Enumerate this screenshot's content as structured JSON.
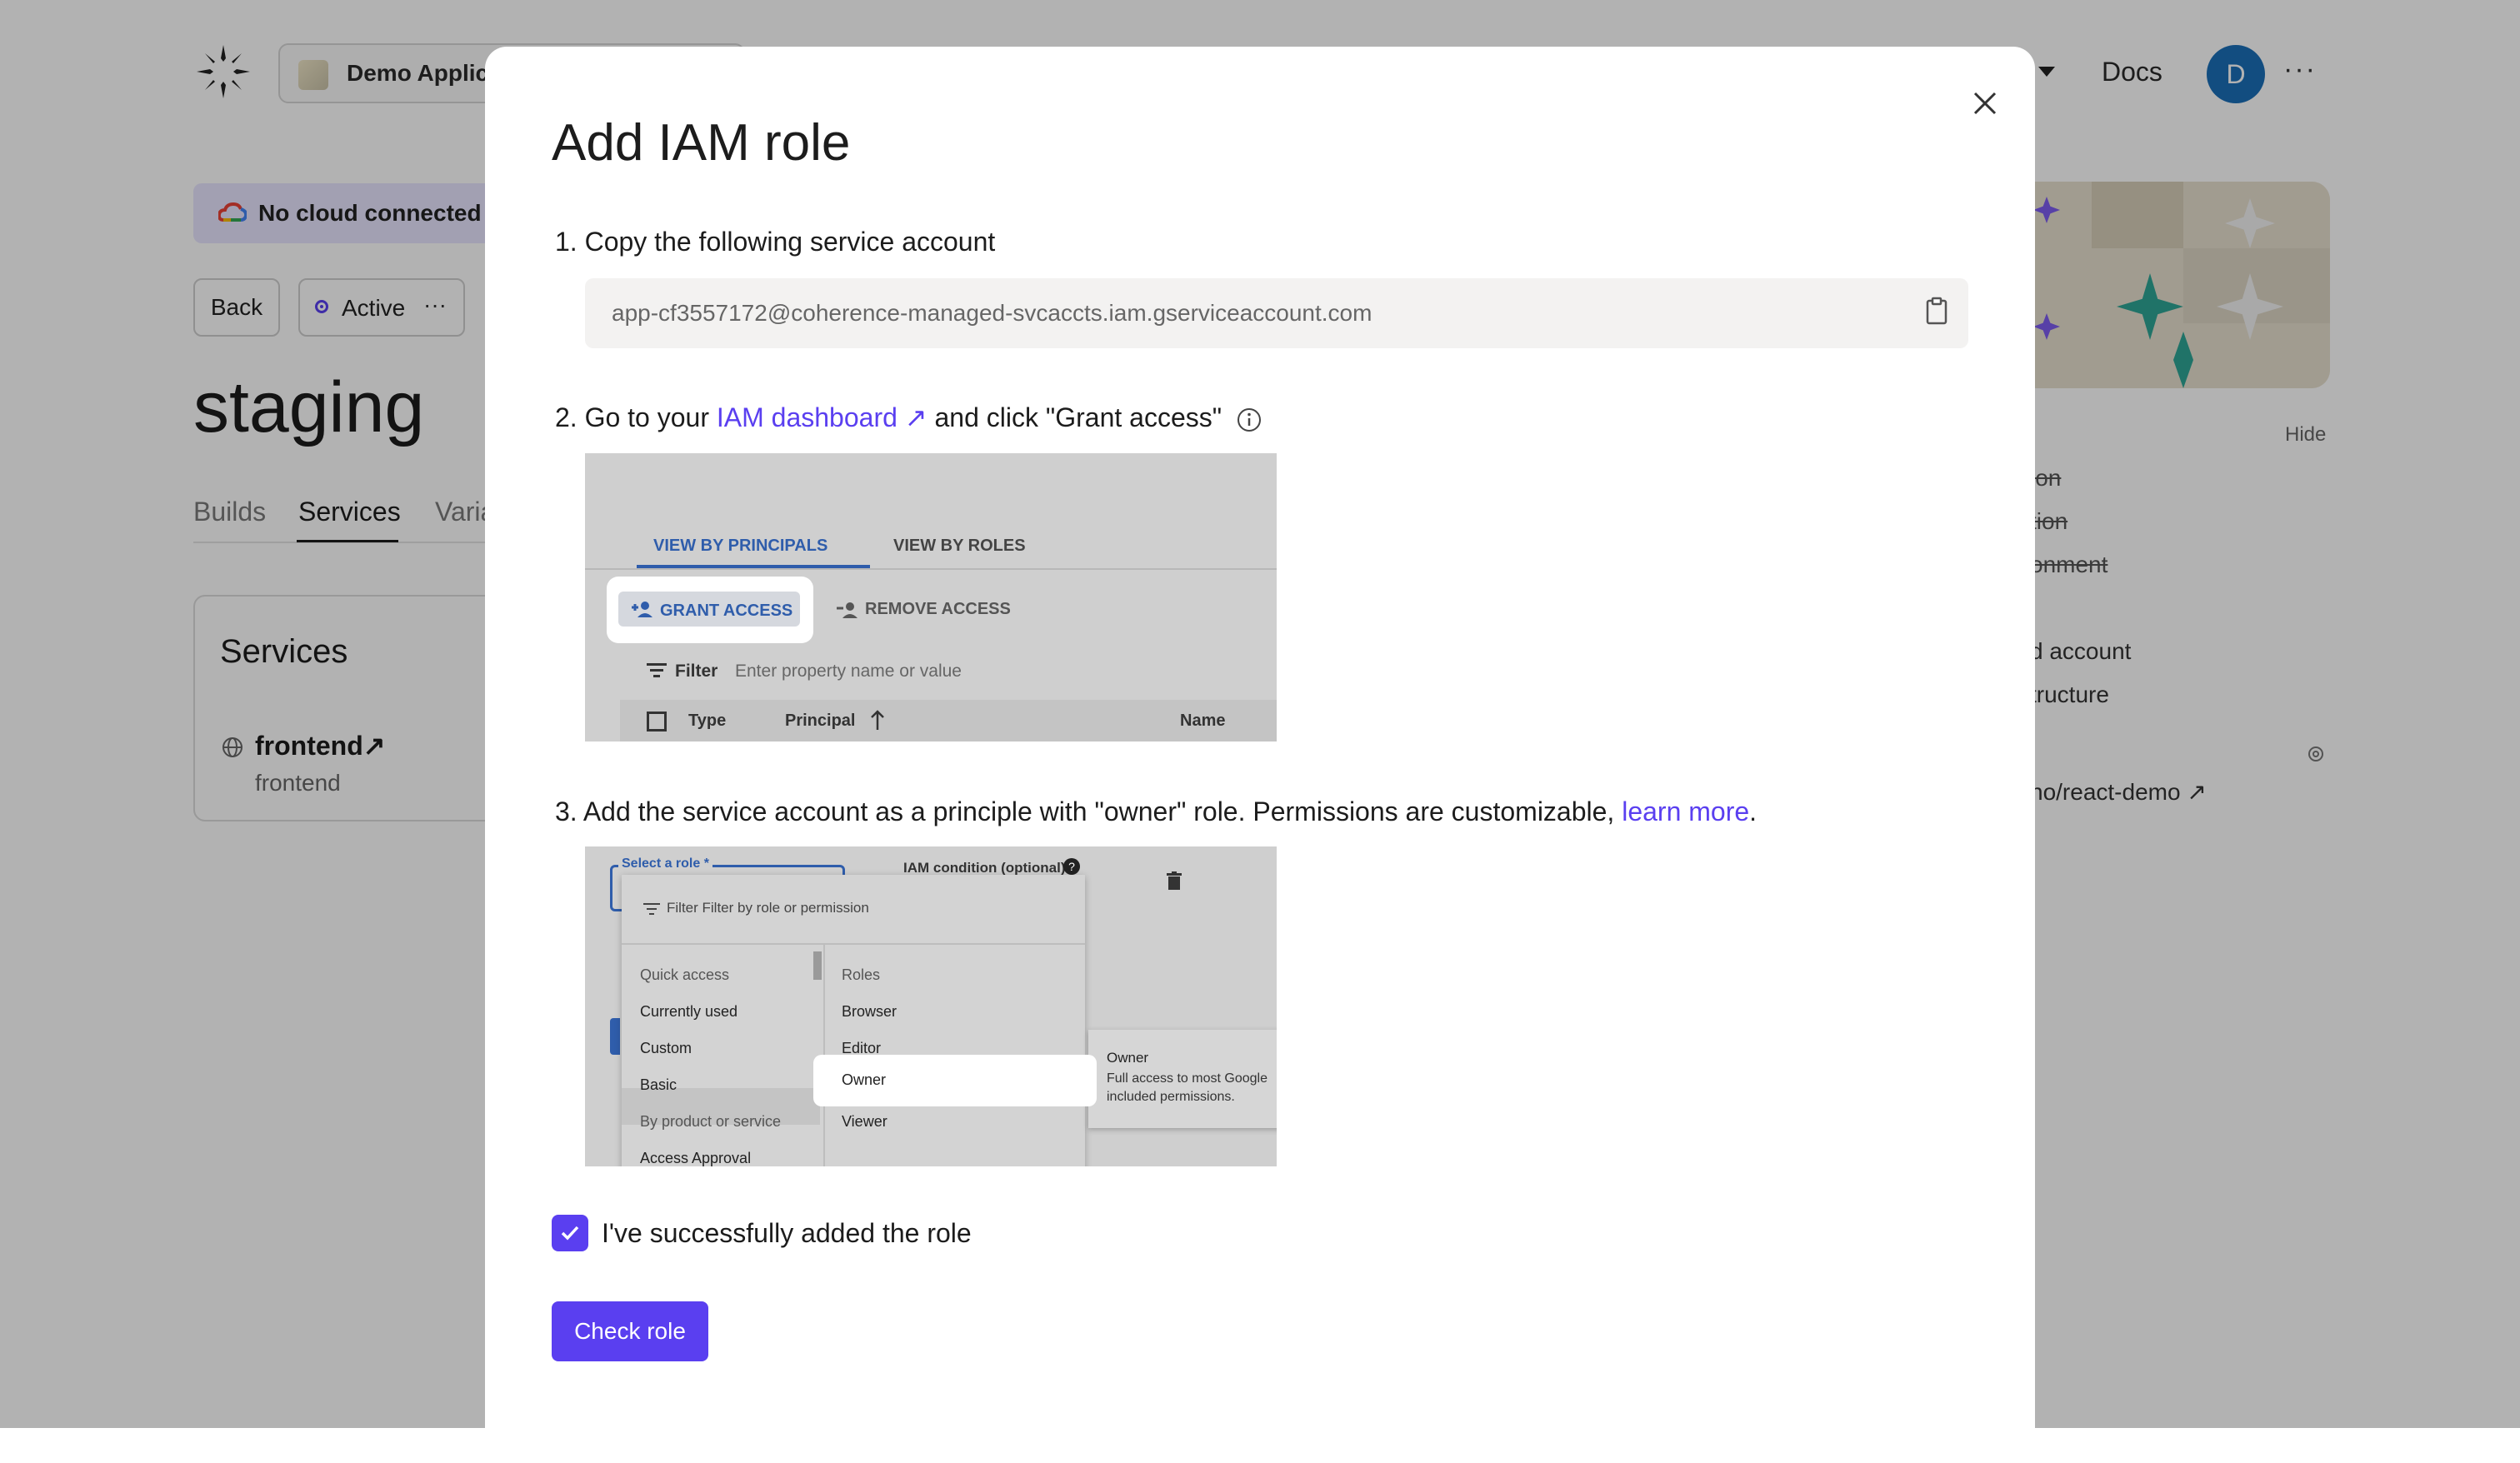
{
  "app": {
    "project_name": "Demo Applic",
    "docs_label": "Docs",
    "avatar_initial": "D",
    "more_label": "···",
    "cloud_banner": "No cloud connected",
    "back_label": "Back",
    "status_label": "Active",
    "status_more": "···",
    "environment_title": "staging",
    "tabs": [
      {
        "label": "Builds"
      },
      {
        "label": "Services"
      },
      {
        "label": "Varia"
      }
    ],
    "services_card": {
      "title": "Services",
      "service_name": "frontend↗",
      "service_sub": "frontend"
    },
    "side_panel": {
      "hide_label": "Hide",
      "struck_items": [
        "ion",
        "tion",
        "onment"
      ],
      "items": [
        "d account",
        "tructure"
      ],
      "repo_link": "no/react-demo ↗"
    }
  },
  "modal": {
    "title": "Add IAM role",
    "step1": "1. Copy the following service account",
    "service_account": "app-cf3557172@coherence-managed-svcaccts.iam.gserviceaccount.com",
    "step2_prefix": "2. Go to your ",
    "step2_link": "IAM dashboard ↗",
    "step2_suffix": " and click \"Grant access\"",
    "step3_text": "3. Add the service account as a principle with \"owner\" role. Permissions are customizable, ",
    "step3_link": "learn more",
    "step3_end": ".",
    "checkbox_label": "I've successfully added the role",
    "checkbox_checked": true,
    "button_label": "Check role",
    "accent_color": "#5a3ff0"
  },
  "screenshot1": {
    "tab_principals": "VIEW BY PRINCIPALS",
    "tab_roles": "VIEW BY ROLES",
    "grant_access": "GRANT ACCESS",
    "remove_access": "REMOVE ACCESS",
    "filter_label": "Filter",
    "filter_placeholder": "Enter property name or value",
    "columns": [
      "Type",
      "Principal",
      "Name"
    ]
  },
  "screenshot2": {
    "select_role_label": "Select a role *",
    "iam_condition": "IAM condition (optional)",
    "filter_text": "Filter Filter by role or permission",
    "left_items": [
      {
        "label": "Quick access",
        "muted": true
      },
      {
        "label": "Currently used",
        "muted": false
      },
      {
        "label": "Custom",
        "muted": false
      },
      {
        "label": "Basic",
        "muted": false
      },
      {
        "label": "By product or service",
        "muted": true
      },
      {
        "label": "Access Approval",
        "muted": false
      }
    ],
    "right_items": [
      {
        "label": "Roles"
      },
      {
        "label": "Browser"
      },
      {
        "label": "Editor"
      },
      {
        "label": "Owner"
      },
      {
        "label": "Viewer"
      }
    ],
    "tooltip_title": "Owner",
    "tooltip_body": "Full access to most Google included permissions."
  }
}
